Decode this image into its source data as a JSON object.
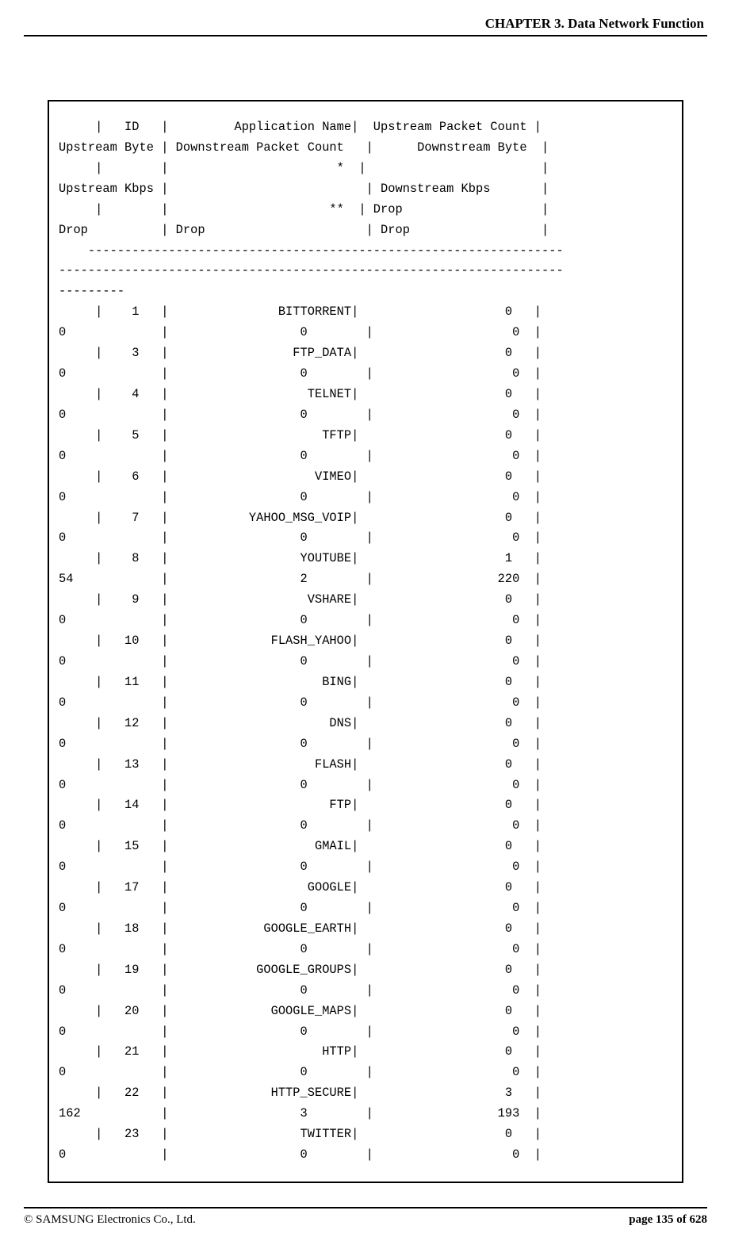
{
  "chapter_header": "CHAPTER 3. Data Network Function",
  "footer": {
    "copyright": "© SAMSUNG Electronics Co., Ltd.",
    "page": "page 135 of 628"
  },
  "terminal": {
    "header_lines": [
      "     |   ID   |         Application Name|  Upstream Packet Count |  ",
      "Upstream Byte | Downstream Packet Count   |      Downstream Byte  |",
      "     |        |                       *  |                        |  ",
      "Upstream Kbps |                           | Downstream Kbps       |",
      "     |        |                      **  | Drop                   |  ",
      "Drop          | Drop                      | Drop                  |"
    ],
    "separator": "    -----------------------------------------------------------------\n---------------------------------------------------------------------\n---------",
    "rows": [
      {
        "id": "1",
        "name": "BITTORRENT",
        "up_pkt": "0",
        "up_byte": "0",
        "down_pkt": "0",
        "down_byte": "0"
      },
      {
        "id": "3",
        "name": "FTP_DATA",
        "up_pkt": "0",
        "up_byte": "0",
        "down_pkt": "0",
        "down_byte": "0"
      },
      {
        "id": "4",
        "name": "TELNET",
        "up_pkt": "0",
        "up_byte": "0",
        "down_pkt": "0",
        "down_byte": "0"
      },
      {
        "id": "5",
        "name": "TFTP",
        "up_pkt": "0",
        "up_byte": "0",
        "down_pkt": "0",
        "down_byte": "0"
      },
      {
        "id": "6",
        "name": "VIMEO",
        "up_pkt": "0",
        "up_byte": "0",
        "down_pkt": "0",
        "down_byte": "0"
      },
      {
        "id": "7",
        "name": "YAHOO_MSG_VOIP",
        "up_pkt": "0",
        "up_byte": "0",
        "down_pkt": "0",
        "down_byte": "0"
      },
      {
        "id": "8",
        "name": "YOUTUBE",
        "up_pkt": "1",
        "up_byte": "54",
        "down_pkt": "2",
        "down_byte": "220"
      },
      {
        "id": "9",
        "name": "VSHARE",
        "up_pkt": "0",
        "up_byte": "0",
        "down_pkt": "0",
        "down_byte": "0"
      },
      {
        "id": "10",
        "name": "FLASH_YAHOO",
        "up_pkt": "0",
        "up_byte": "0",
        "down_pkt": "0",
        "down_byte": "0"
      },
      {
        "id": "11",
        "name": "BING",
        "up_pkt": "0",
        "up_byte": "0",
        "down_pkt": "0",
        "down_byte": "0"
      },
      {
        "id": "12",
        "name": "DNS",
        "up_pkt": "0",
        "up_byte": "0",
        "down_pkt": "0",
        "down_byte": "0"
      },
      {
        "id": "13",
        "name": "FLASH",
        "up_pkt": "0",
        "up_byte": "0",
        "down_pkt": "0",
        "down_byte": "0"
      },
      {
        "id": "14",
        "name": "FTP",
        "up_pkt": "0",
        "up_byte": "0",
        "down_pkt": "0",
        "down_byte": "0"
      },
      {
        "id": "15",
        "name": "GMAIL",
        "up_pkt": "0",
        "up_byte": "0",
        "down_pkt": "0",
        "down_byte": "0"
      },
      {
        "id": "17",
        "name": "GOOGLE",
        "up_pkt": "0",
        "up_byte": "0",
        "down_pkt": "0",
        "down_byte": "0"
      },
      {
        "id": "18",
        "name": "GOOGLE_EARTH",
        "up_pkt": "0",
        "up_byte": "0",
        "down_pkt": "0",
        "down_byte": "0"
      },
      {
        "id": "19",
        "name": "GOOGLE_GROUPS",
        "up_pkt": "0",
        "up_byte": "0",
        "down_pkt": "0",
        "down_byte": "0"
      },
      {
        "id": "20",
        "name": "GOOGLE_MAPS",
        "up_pkt": "0",
        "up_byte": "0",
        "down_pkt": "0",
        "down_byte": "0"
      },
      {
        "id": "21",
        "name": "HTTP",
        "up_pkt": "0",
        "up_byte": "0",
        "down_pkt": "0",
        "down_byte": "0"
      },
      {
        "id": "22",
        "name": "HTTP_SECURE",
        "up_pkt": "3",
        "up_byte": "162",
        "down_pkt": "3",
        "down_byte": "193"
      },
      {
        "id": "23",
        "name": "TWITTER",
        "up_pkt": "0",
        "up_byte": "0",
        "down_pkt": "0",
        "down_byte": "0"
      }
    ]
  }
}
